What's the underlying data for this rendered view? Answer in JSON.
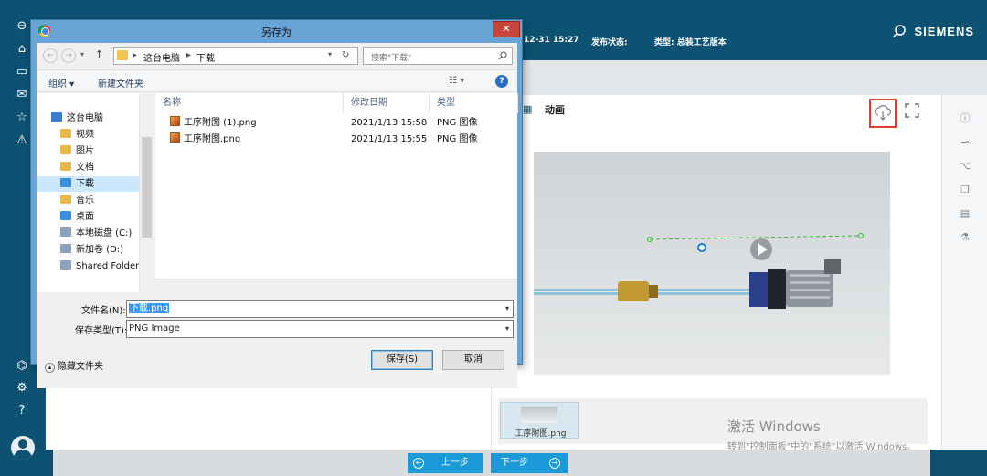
{
  "app": {
    "brand": "SIEMENS",
    "header_meta": [
      {
        "text": "12-31 15:27"
      },
      {
        "text": "发布状态:"
      },
      {
        "text": "类型: 总装工艺版本"
      }
    ],
    "tabs": {
      "animation": "动画"
    },
    "thumbnail_label": "工序附图.png",
    "prev_step": "上一步",
    "next_step": "下一步",
    "watermark": {
      "title": "激活 Windows",
      "subtitle": "转到\"控制面板\"中的\"系统\"以激活 Windows。"
    }
  },
  "dialog": {
    "title": "另存为",
    "breadcrumb": [
      "这台电脑",
      "下载"
    ],
    "search_placeholder": "搜索\"下载\"",
    "toolbar": {
      "organize": "组织 ▾",
      "new_folder": "新建文件夹"
    },
    "nav_items": [
      {
        "label": "这台电脑",
        "icon": "computer-icon",
        "color": "#3a7bd5"
      },
      {
        "label": "视频",
        "icon": "video-folder-icon",
        "color": "#e8b84a"
      },
      {
        "label": "图片",
        "icon": "pictures-folder-icon",
        "color": "#e8b84a"
      },
      {
        "label": "文档",
        "icon": "documents-folder-icon",
        "color": "#e8b84a"
      },
      {
        "label": "下载",
        "icon": "downloads-folder-icon",
        "color": "#3c8ee0",
        "selected": true
      },
      {
        "label": "音乐",
        "icon": "music-folder-icon",
        "color": "#e8b84a"
      },
      {
        "label": "桌面",
        "icon": "desktop-folder-icon",
        "color": "#3c8ee0"
      },
      {
        "label": "本地磁盘 (C:)",
        "icon": "drive-c-icon",
        "color": "#8aa2b8"
      },
      {
        "label": "新加卷 (D:)",
        "icon": "drive-d-icon",
        "color": "#8aa2b8"
      },
      {
        "label": "Shared Folders",
        "icon": "network-drive-icon",
        "color": "#8aa2b8"
      }
    ],
    "columns": [
      "名称",
      "修改日期",
      "类型"
    ],
    "files": [
      {
        "name": "工序附图 (1).png",
        "date": "2021/1/13 15:58",
        "type": "PNG 图像"
      },
      {
        "name": "工序附图.png",
        "date": "2021/1/13 15:55",
        "type": "PNG 图像"
      }
    ],
    "filename_label": "文件名(N):",
    "filename_value": "下载.png",
    "filetype_label": "保存类型(T):",
    "filetype_value": "PNG Image",
    "hide_folders": "隐藏文件夹",
    "save_button": "保存(S)",
    "cancel_button": "取消"
  }
}
